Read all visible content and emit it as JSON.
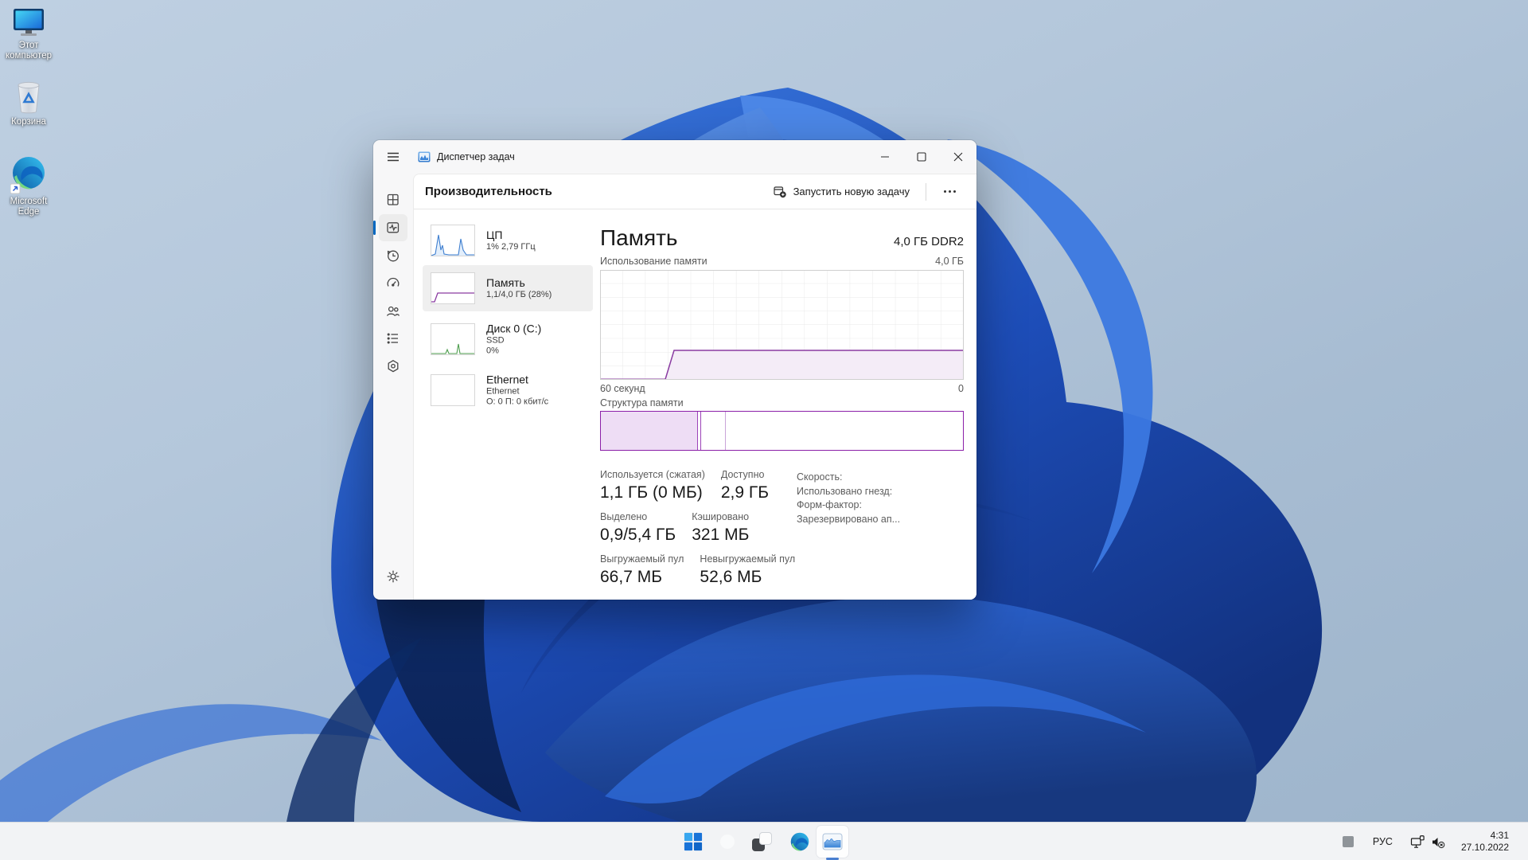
{
  "desktop": {
    "icons": [
      {
        "label": "Этот компьютер"
      },
      {
        "label": "Корзина"
      },
      {
        "label": "Microsoft Edge"
      }
    ]
  },
  "window": {
    "title": "Диспетчер задач",
    "header": {
      "title": "Производительность",
      "run_new_task": "Запустить новую задачу"
    },
    "perf_list": [
      {
        "name": "ЦП",
        "lines": [
          "1% 2,79 ГГц"
        ],
        "selected": false
      },
      {
        "name": "Память",
        "lines": [
          "1,1/4,0 ГБ (28%)"
        ],
        "selected": true
      },
      {
        "name": "Диск 0 (C:)",
        "lines": [
          "SSD",
          "0%"
        ],
        "selected": false
      },
      {
        "name": "Ethernet",
        "lines": [
          "Ethernet",
          "О: 0 П: 0 кбит/с"
        ],
        "selected": false
      }
    ],
    "memory": {
      "title": "Память",
      "capacity": "4,0 ГБ DDR2",
      "graph_label": "Использование памяти",
      "graph_max": "4,0 ГБ",
      "time_left": "60 секунд",
      "time_right": "0",
      "composition_label": "Структура памяти",
      "stats": [
        {
          "label": "Используется (сжатая)",
          "value": "1,1 ГБ (0 МБ)"
        },
        {
          "label": "Доступно",
          "value": "2,9 ГБ"
        },
        {
          "label": "Выделено",
          "value": "0,9/5,4 ГБ"
        },
        {
          "label": "Кэшировано",
          "value": "321 МБ"
        },
        {
          "label": "Выгружаемый пул",
          "value": "66,7 МБ"
        },
        {
          "label": "Невыгружаемый пул",
          "value": "52,6 МБ"
        }
      ],
      "info_labels": [
        "Скорость:",
        "Использовано гнезд:",
        "Форм-фактор:",
        "Зарезервировано ап..."
      ]
    }
  },
  "taskbar_icons": [
    "start",
    "search",
    "task-view",
    "edge",
    "task-manager"
  ],
  "tray": {
    "lang": "РУС",
    "time": "4:31",
    "date": "27.10.2022"
  },
  "icons": {
    "sidebar": [
      "menu",
      "processes",
      "performance",
      "app-history",
      "startup-apps",
      "users",
      "details",
      "services",
      "settings"
    ],
    "tray": [
      "tray-app",
      "network-ethernet",
      "volume-muted"
    ],
    "window_controls": [
      "minimize",
      "maximize",
      "close"
    ]
  },
  "colors": {
    "accent_blue": "#0067c0",
    "memory_purple_line": "#8a3ba1",
    "memory_purple_fill": "#f4ecf7",
    "composition_border": "#8b1fa8",
    "taskbar_bg": "#f2f3f5"
  },
  "chart_data": {
    "type": "area",
    "title": "Использование памяти",
    "x_left_label": "60 секунд",
    "x_right_label": "0",
    "x_range_seconds": [
      -60,
      0
    ],
    "ylim_gb": [
      0,
      4.0
    ],
    "y_max_label": "4,0 ГБ",
    "series": [
      {
        "name": "Память",
        "points_t_gb": [
          [
            -60,
            0
          ],
          [
            -51,
            0
          ],
          [
            -49,
            1.12
          ],
          [
            0,
            1.12
          ]
        ]
      }
    ],
    "plateau_percent": 28,
    "grid": "on",
    "composition_bar_segments_percent": [
      26.8,
      1.0,
      6.7,
      65.5
    ]
  }
}
